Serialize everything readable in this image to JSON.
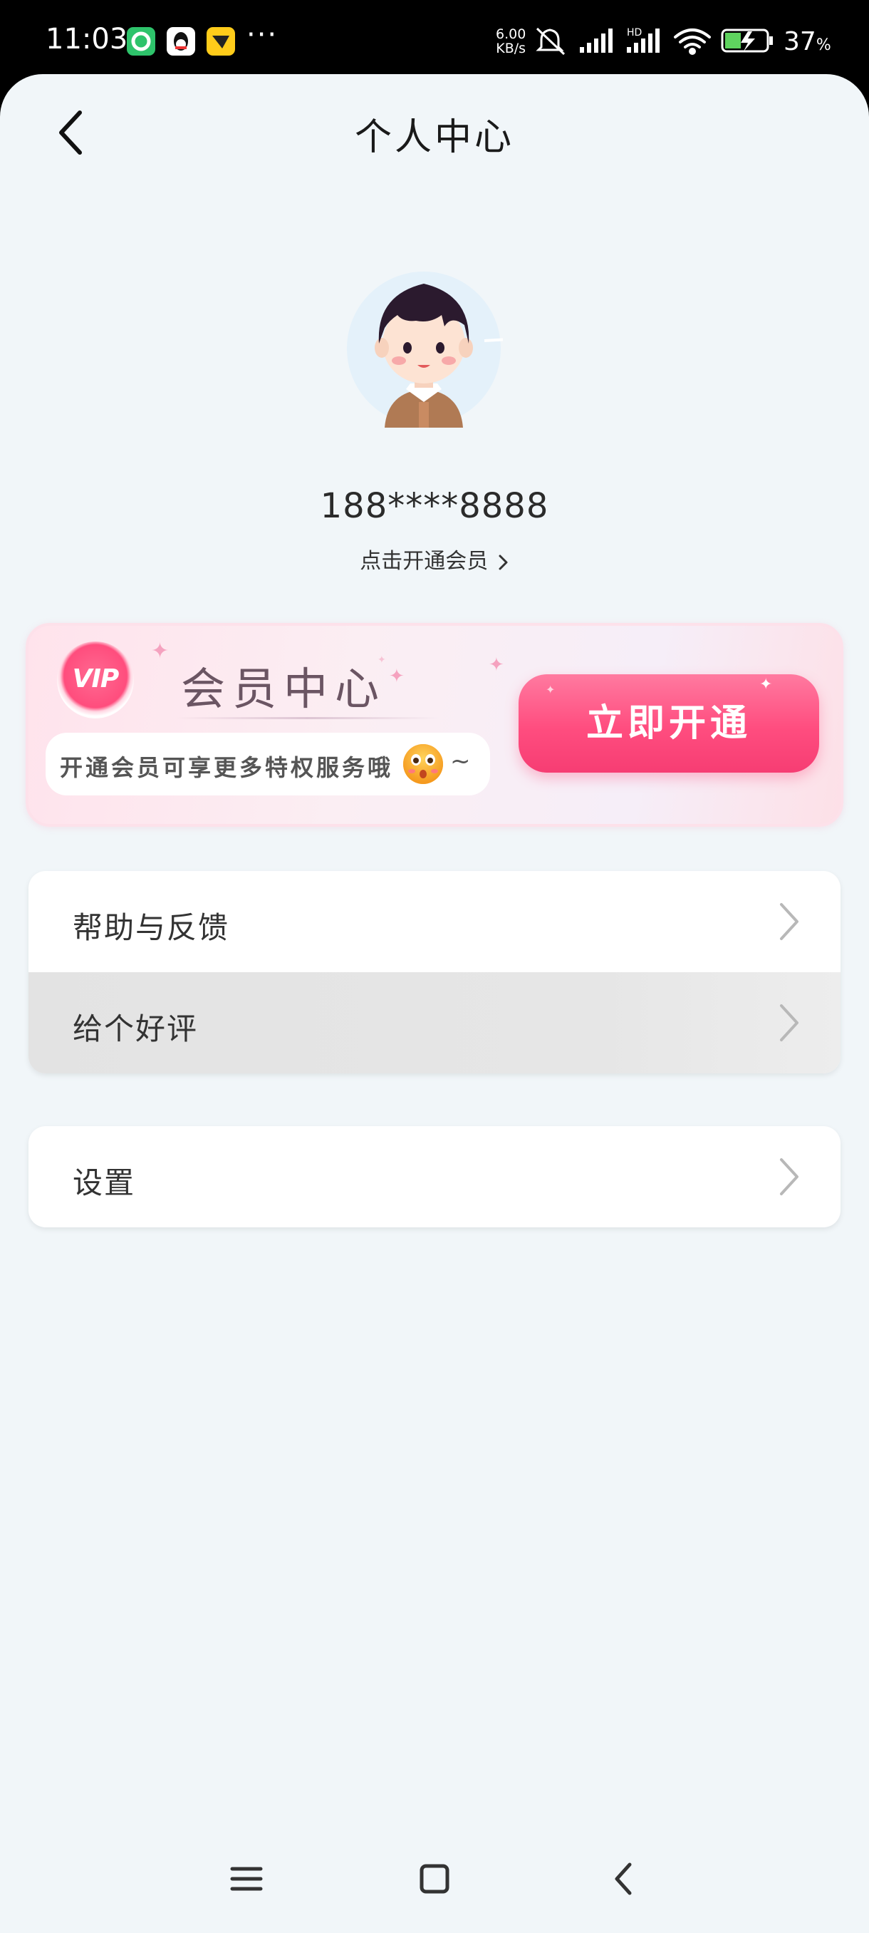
{
  "status_bar": {
    "time": "11:03",
    "network_speed_value": "6.00",
    "network_speed_unit": "KB/s",
    "hd_label": "HD",
    "battery_percent": "37",
    "battery_unit": "%",
    "notification_dots": "···"
  },
  "header": {
    "title": "个人中心"
  },
  "profile": {
    "phone": "188****8888",
    "open_vip_link": "点击开通会员"
  },
  "vip_card": {
    "badge": "VIP",
    "title": "会员中心",
    "description": "开通会员可享更多特权服务哦",
    "tilde": "~",
    "open_button": "立即开通"
  },
  "menu": {
    "group1": [
      {
        "label": "帮助与反馈"
      },
      {
        "label": "给个好评"
      }
    ],
    "group2": [
      {
        "label": "设置"
      }
    ]
  },
  "colors": {
    "page_background": "#f1f6f9",
    "accent_pink": "#ff4d7f",
    "status_bar": "#000000"
  }
}
